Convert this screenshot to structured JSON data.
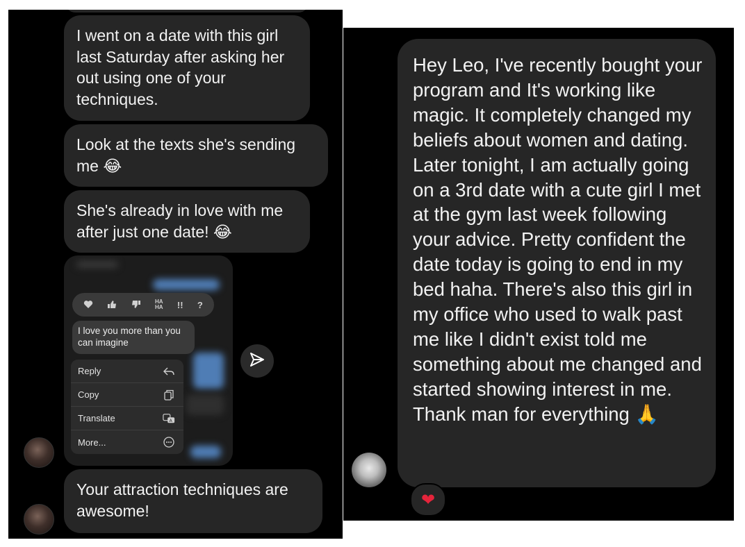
{
  "left_chat": {
    "messages": [
      "I went on a date with this girl last Saturday after asking her out using one of your techniques.",
      "Look at the texts she's sending me 😂",
      "She's already in love with me after just one date! 😂",
      "Your attraction techniques are awesome!"
    ],
    "screenshot": {
      "quoted_message": "I love you more than you can imagine",
      "reactions": [
        "heart",
        "thumbs-up",
        "thumbs-down",
        "HA HA",
        "!!",
        "?"
      ],
      "menu": [
        {
          "label": "Reply",
          "icon": "reply-icon"
        },
        {
          "label": "Copy",
          "icon": "copy-icon"
        },
        {
          "label": "Translate",
          "icon": "translate-icon"
        },
        {
          "label": "More...",
          "icon": "more-icon"
        }
      ]
    }
  },
  "right_chat": {
    "message": "Hey Leo, I've recently bought your program and It's working like magic. It completely changed my beliefs about women and dating. Later tonight, I am actually going on a 3rd date with a cute girl I met at the gym last week following your advice. Pretty confident the date today is going to end in my bed haha. There's also this girl in my office who used to walk past me like I didn't exist told me something about me changed and started showing interest in me. Thank man for everything 🙏",
    "reaction": "❤"
  },
  "colors": {
    "background": "#000000",
    "bubble": "#262626",
    "text": "#f2f2f2",
    "heart": "#e5243b"
  }
}
